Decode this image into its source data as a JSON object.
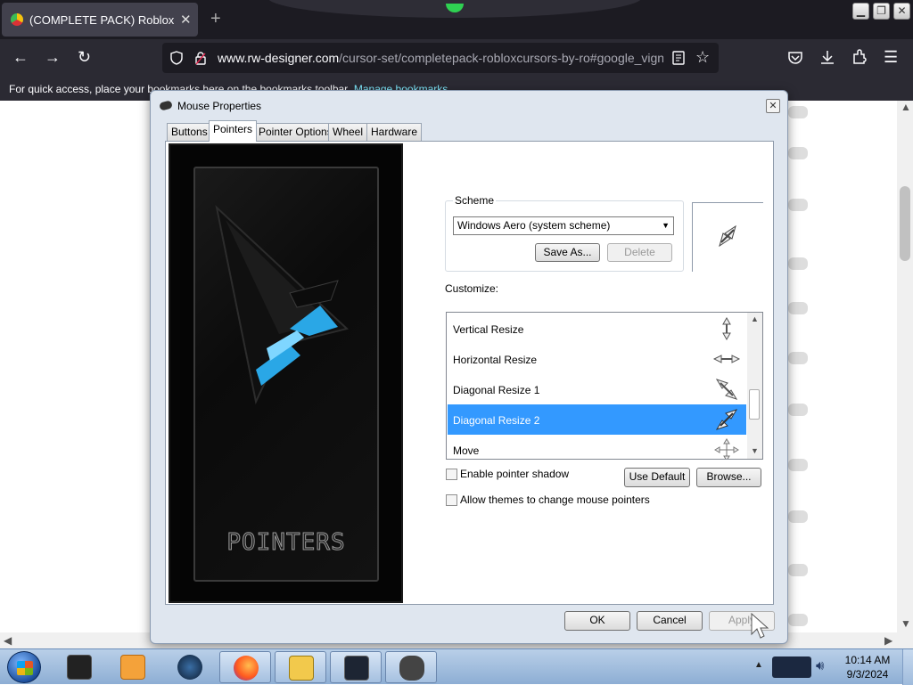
{
  "browser": {
    "tab_title": "(COMPLETE PACK) Roblox Cur",
    "tab_close": "✕",
    "new_tab": "+",
    "url_host": "www.rw-designer.com",
    "url_path": "/cursor-set/completepack-robloxcursors-by-ro#google_vign",
    "bookmarks_text": "For quick access, place your bookmarks here on the bookmarks toolbar.",
    "bookmarks_link": "Manage bookmarks…"
  },
  "dialog": {
    "title": "Mouse Properties",
    "tabs": [
      "Buttons",
      "Pointers",
      "Pointer Options",
      "Wheel",
      "Hardware"
    ],
    "active_tab": "Pointers",
    "preview_caption": "POINTERS",
    "scheme": {
      "legend": "Scheme",
      "selected": "Windows Aero (system scheme)",
      "save_as": "Save As...",
      "delete": "Delete"
    },
    "customize_label": "Customize:",
    "cursor_rows": [
      {
        "label": "Vertical Resize",
        "icon": "vertical-resize-icon"
      },
      {
        "label": "Horizontal Resize",
        "icon": "horizontal-resize-icon"
      },
      {
        "label": "Diagonal Resize 1",
        "icon": "diagonal-resize-1-icon"
      },
      {
        "label": "Diagonal Resize 2",
        "icon": "diagonal-resize-2-icon"
      },
      {
        "label": "Move",
        "icon": "move-icon"
      }
    ],
    "selected_row": "Diagonal Resize 2",
    "enable_shadow": "Enable pointer shadow",
    "allow_themes": "Allow themes to change mouse pointers",
    "use_default": "Use Default",
    "browse": "Browse...",
    "ok": "OK",
    "cancel": "Cancel",
    "apply": "Apply"
  },
  "taskbar": {
    "time": "10:14 AM",
    "date": "9/3/2024"
  },
  "colors": {
    "selection": "#3399ff",
    "browser_dark": "#2b2a33",
    "link": "#80ebff"
  }
}
